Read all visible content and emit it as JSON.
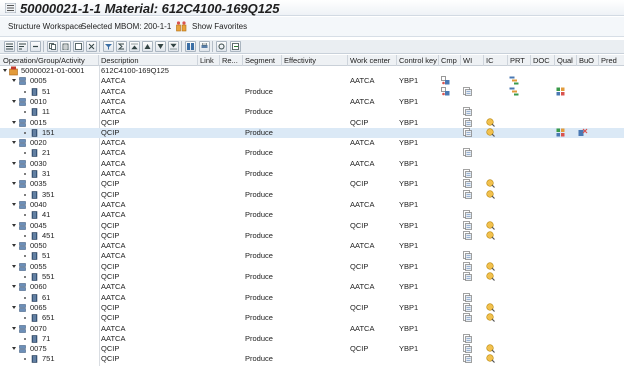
{
  "title": "50000021-1-1 Material: 612C4100-169Q125",
  "appbar": {
    "workspace": "Structure Workspace",
    "selected_mbom": "Selected MBOM: 200-1-1",
    "favorites": "Show Favorites"
  },
  "toolbar": {
    "icons": [
      "expand-all-icon",
      "collapse-all-icon",
      "collapse-icon",
      "copy-icon",
      "paste-icon",
      "duplicate-icon",
      "cut-icon",
      "filter-icon",
      "sum-icon",
      "move-top-icon",
      "move-up-icon",
      "move-down-icon",
      "move-bottom-icon",
      "layout-icon",
      "print-icon",
      "settings-icon",
      "export-icon"
    ]
  },
  "columns": [
    "Operation/Group/Activity",
    "Description",
    "Link",
    "Re...",
    "Segment",
    "Effectivity",
    "Work center",
    "Control key",
    "Cmp",
    "WI",
    "IC",
    "PRT",
    "DOC",
    "Qual",
    "BuO",
    "Pred"
  ],
  "rows": [
    {
      "id": "50000021-01-0001",
      "desc": "612C4100-169Q125",
      "level": 0,
      "segment": "",
      "wc": "",
      "ck": "",
      "cmp": false,
      "wi": false,
      "ic": false,
      "prt": false,
      "qual": false,
      "buo": false,
      "sel": false
    },
    {
      "id": "0005",
      "desc": "AATCA",
      "level": 1,
      "segment": "",
      "wc": "AATCA",
      "ck": "YBP1",
      "cmp": true,
      "wi": false,
      "ic": false,
      "prt": true,
      "qual": false,
      "buo": false,
      "sel": false
    },
    {
      "id": "51",
      "desc": "AATCA",
      "level": 2,
      "segment": "Produce",
      "wc": "",
      "ck": "",
      "cmp": true,
      "wi": true,
      "ic": false,
      "prt": true,
      "qual": true,
      "buo": false,
      "sel": false
    },
    {
      "id": "0010",
      "desc": "AATCA",
      "level": 1,
      "segment": "",
      "wc": "AATCA",
      "ck": "YBP1",
      "cmp": false,
      "wi": false,
      "ic": false,
      "prt": false,
      "qual": false,
      "buo": false,
      "sel": false
    },
    {
      "id": "11",
      "desc": "AATCA",
      "level": 2,
      "segment": "Produce",
      "wc": "",
      "ck": "",
      "cmp": false,
      "wi": true,
      "ic": false,
      "prt": false,
      "qual": false,
      "buo": false,
      "sel": false
    },
    {
      "id": "0015",
      "desc": "QCIP",
      "level": 1,
      "segment": "",
      "wc": "QCIP",
      "ck": "YBP1",
      "cmp": false,
      "wi": true,
      "ic": true,
      "prt": false,
      "qual": false,
      "buo": false,
      "sel": false
    },
    {
      "id": "151",
      "desc": "QCIP",
      "level": 2,
      "segment": "Produce",
      "wc": "",
      "ck": "",
      "cmp": false,
      "wi": true,
      "ic": true,
      "prt": false,
      "qual": true,
      "buo": true,
      "sel": true
    },
    {
      "id": "0020",
      "desc": "AATCA",
      "level": 1,
      "segment": "",
      "wc": "AATCA",
      "ck": "YBP1",
      "cmp": false,
      "wi": false,
      "ic": false,
      "prt": false,
      "qual": false,
      "buo": false,
      "sel": false
    },
    {
      "id": "21",
      "desc": "AATCA",
      "level": 2,
      "segment": "Produce",
      "wc": "",
      "ck": "",
      "cmp": false,
      "wi": true,
      "ic": false,
      "prt": false,
      "qual": false,
      "buo": false,
      "sel": false
    },
    {
      "id": "0030",
      "desc": "AATCA",
      "level": 1,
      "segment": "",
      "wc": "AATCA",
      "ck": "YBP1",
      "cmp": false,
      "wi": false,
      "ic": false,
      "prt": false,
      "qual": false,
      "buo": false,
      "sel": false
    },
    {
      "id": "31",
      "desc": "AATCA",
      "level": 2,
      "segment": "Produce",
      "wc": "",
      "ck": "",
      "cmp": false,
      "wi": true,
      "ic": false,
      "prt": false,
      "qual": false,
      "buo": false,
      "sel": false
    },
    {
      "id": "0035",
      "desc": "QCIP",
      "level": 1,
      "segment": "",
      "wc": "QCIP",
      "ck": "YBP1",
      "cmp": false,
      "wi": true,
      "ic": true,
      "prt": false,
      "qual": false,
      "buo": false,
      "sel": false
    },
    {
      "id": "351",
      "desc": "QCIP",
      "level": 2,
      "segment": "Produce",
      "wc": "",
      "ck": "",
      "cmp": false,
      "wi": true,
      "ic": true,
      "prt": false,
      "qual": false,
      "buo": false,
      "sel": false
    },
    {
      "id": "0040",
      "desc": "AATCA",
      "level": 1,
      "segment": "",
      "wc": "AATCA",
      "ck": "YBP1",
      "cmp": false,
      "wi": false,
      "ic": false,
      "prt": false,
      "qual": false,
      "buo": false,
      "sel": false
    },
    {
      "id": "41",
      "desc": "AATCA",
      "level": 2,
      "segment": "Produce",
      "wc": "",
      "ck": "",
      "cmp": false,
      "wi": true,
      "ic": false,
      "prt": false,
      "qual": false,
      "buo": false,
      "sel": false
    },
    {
      "id": "0045",
      "desc": "QCIP",
      "level": 1,
      "segment": "",
      "wc": "QCIP",
      "ck": "YBP1",
      "cmp": false,
      "wi": true,
      "ic": true,
      "prt": false,
      "qual": false,
      "buo": false,
      "sel": false
    },
    {
      "id": "451",
      "desc": "QCIP",
      "level": 2,
      "segment": "Produce",
      "wc": "",
      "ck": "",
      "cmp": false,
      "wi": true,
      "ic": true,
      "prt": false,
      "qual": false,
      "buo": false,
      "sel": false
    },
    {
      "id": "0050",
      "desc": "AATCA",
      "level": 1,
      "segment": "",
      "wc": "AATCA",
      "ck": "YBP1",
      "cmp": false,
      "wi": false,
      "ic": false,
      "prt": false,
      "qual": false,
      "buo": false,
      "sel": false
    },
    {
      "id": "51",
      "desc": "AATCA",
      "level": 2,
      "segment": "Produce",
      "wc": "",
      "ck": "",
      "cmp": false,
      "wi": true,
      "ic": false,
      "prt": false,
      "qual": false,
      "buo": false,
      "sel": false
    },
    {
      "id": "0055",
      "desc": "QCIP",
      "level": 1,
      "segment": "",
      "wc": "QCIP",
      "ck": "YBP1",
      "cmp": false,
      "wi": true,
      "ic": true,
      "prt": false,
      "qual": false,
      "buo": false,
      "sel": false
    },
    {
      "id": "551",
      "desc": "QCIP",
      "level": 2,
      "segment": "Produce",
      "wc": "",
      "ck": "",
      "cmp": false,
      "wi": true,
      "ic": true,
      "prt": false,
      "qual": false,
      "buo": false,
      "sel": false
    },
    {
      "id": "0060",
      "desc": "AATCA",
      "level": 1,
      "segment": "",
      "wc": "AATCA",
      "ck": "YBP1",
      "cmp": false,
      "wi": false,
      "ic": false,
      "prt": false,
      "qual": false,
      "buo": false,
      "sel": false
    },
    {
      "id": "61",
      "desc": "AATCA",
      "level": 2,
      "segment": "Produce",
      "wc": "",
      "ck": "",
      "cmp": false,
      "wi": true,
      "ic": false,
      "prt": false,
      "qual": false,
      "buo": false,
      "sel": false
    },
    {
      "id": "0065",
      "desc": "QCIP",
      "level": 1,
      "segment": "",
      "wc": "QCIP",
      "ck": "YBP1",
      "cmp": false,
      "wi": true,
      "ic": true,
      "prt": false,
      "qual": false,
      "buo": false,
      "sel": false
    },
    {
      "id": "651",
      "desc": "QCIP",
      "level": 2,
      "segment": "Produce",
      "wc": "",
      "ck": "",
      "cmp": false,
      "wi": true,
      "ic": true,
      "prt": false,
      "qual": false,
      "buo": false,
      "sel": false
    },
    {
      "id": "0070",
      "desc": "AATCA",
      "level": 1,
      "segment": "",
      "wc": "AATCA",
      "ck": "YBP1",
      "cmp": false,
      "wi": false,
      "ic": false,
      "prt": false,
      "qual": false,
      "buo": false,
      "sel": false
    },
    {
      "id": "71",
      "desc": "AATCA",
      "level": 2,
      "segment": "Produce",
      "wc": "",
      "ck": "",
      "cmp": false,
      "wi": true,
      "ic": false,
      "prt": false,
      "qual": false,
      "buo": false,
      "sel": false
    },
    {
      "id": "0075",
      "desc": "QCIP",
      "level": 1,
      "segment": "",
      "wc": "QCIP",
      "ck": "YBP1",
      "cmp": false,
      "wi": true,
      "ic": true,
      "prt": false,
      "qual": false,
      "buo": false,
      "sel": false
    },
    {
      "id": "751",
      "desc": "QCIP",
      "level": 2,
      "segment": "Produce",
      "wc": "",
      "ck": "",
      "cmp": false,
      "wi": true,
      "ic": true,
      "prt": false,
      "qual": false,
      "buo": false,
      "sel": false
    }
  ],
  "colors": {
    "selected_row": "#dbe9f6",
    "header_bg": "#eef1f4"
  }
}
